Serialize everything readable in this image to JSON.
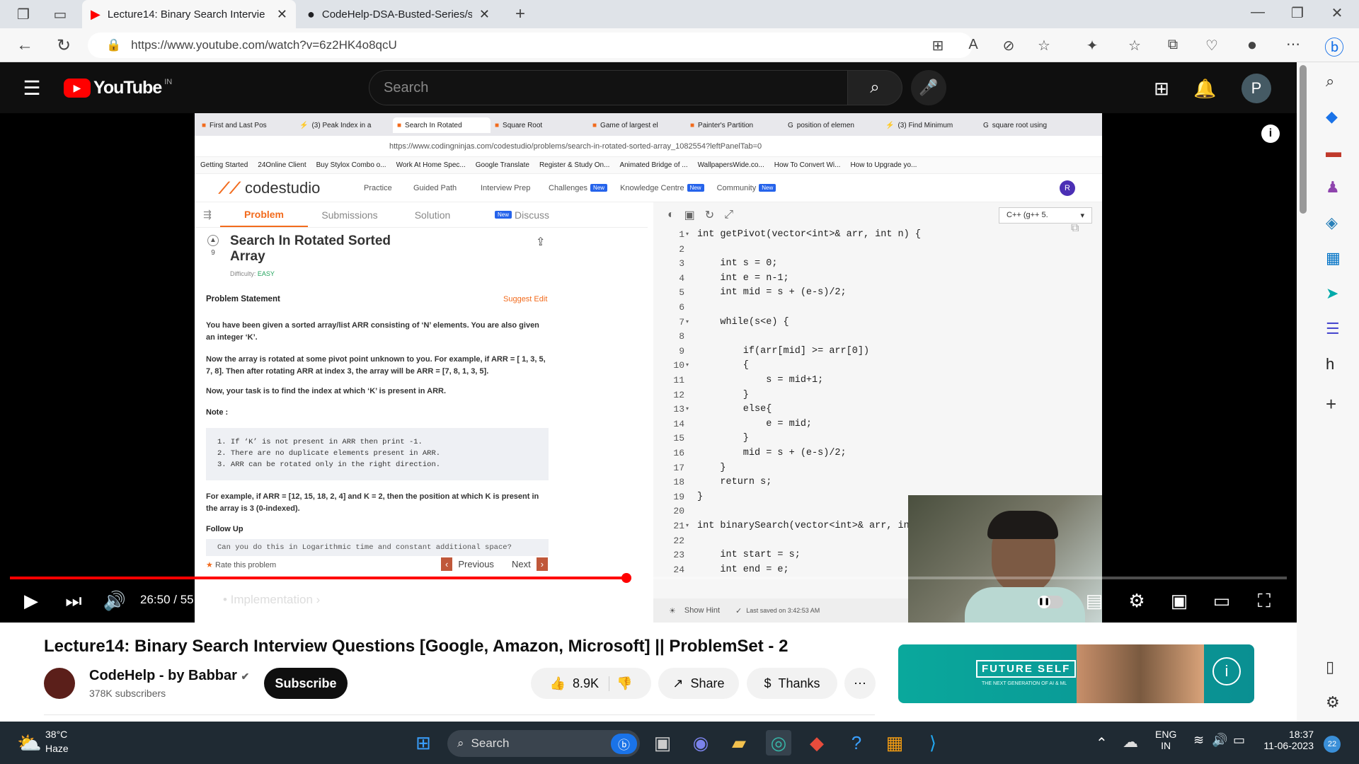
{
  "browser": {
    "tabs": [
      {
        "title": "Lecture14: Binary Search Intervie",
        "icon": "youtube-icon",
        "active": true
      },
      {
        "title": "CodeHelp-DSA-Busted-Series/se",
        "icon": "github-icon",
        "active": false
      }
    ],
    "url": "https://www.youtube.com/watch?v=6z2HK4o8qcU"
  },
  "youtube": {
    "logo": "YouTube",
    "country": "IN",
    "search_placeholder": "Search",
    "avatar_letter": "P"
  },
  "video": {
    "inner_tabs": [
      "First and Last Pos",
      "(3) Peak Index in a",
      "Search In Rotated",
      "Square Root",
      "Game of largest el",
      "Painter's Partition",
      "position of elemen",
      "(3) Find Minimum",
      "square root using"
    ],
    "inner_url": "https://www.codingninjas.com/codestudio/problems/search-in-rotated-sorted-array_1082554?leftPanelTab=0",
    "bookmarks": [
      "Getting Started",
      "24Online Client",
      "Buy Stylox Combo o...",
      "Work At Home Spec...",
      "Google Translate",
      "Register & Study On...",
      "Animated Bridge of ...",
      "WallpapersWide.co...",
      "How To Convert Wi...",
      "How to Upgrade yo..."
    ],
    "codestudio": {
      "logo": "codestudio",
      "nav": [
        "Practice",
        "Guided Path",
        "Interview Prep",
        "Challenges",
        "Knowledge Centre",
        "Community"
      ],
      "new_badge": "New",
      "user_initial": "R",
      "problem_tabs": [
        "Problem",
        "Submissions",
        "Solution",
        "Discuss"
      ],
      "upvotes": "9",
      "problem_title_line1": "Search In Rotated Sorted",
      "problem_title_line2": "Array",
      "difficulty_label": "Difficulty:",
      "difficulty": "EASY",
      "statement_heading": "Problem Statement",
      "suggest_edit": "Suggest Edit",
      "para1": "You have been given a sorted array/list ARR consisting of ‘N’ elements. You are also given an integer ‘K’.",
      "para2": "Now the array is rotated at some pivot point unknown to you. For example, if ARR = [ 1, 3, 5, 7, 8]. Then after rotating ARR at index 3, the array will be ARR = [7, 8, 1, 3, 5].",
      "para3": "Now, your task is to find the index at which ‘K’ is present in ARR.",
      "note": "Note :",
      "notes": [
        "1. If ‘K’ is not present in ARR then print -1.",
        "2. There are no duplicate elements present in ARR.",
        "3. ARR can be rotated only in the right direction."
      ],
      "example": "For example, if ARR = [12, 15, 18, 2, 4] and K = 2, then the position at which K is present in the array is 3 (0-indexed).",
      "follow_up": "Follow Up",
      "follow_up_text": "Can you do this in Logarithmic time and constant additional space?",
      "rate": "Rate this problem",
      "previous": "Previous",
      "next": "Next",
      "language": "C++ (g++ 5.",
      "show_hint": "Show Hint",
      "last_saved": "Last saved on 3:42:53 AM",
      "code": [
        "int getPivot(vector<int>& arr, int n) {",
        "",
        "    int s = 0;",
        "    int e = n-1;",
        "    int mid = s + (e-s)/2;",
        "",
        "    while(s<e) {",
        "",
        "        if(arr[mid] >= arr[0])",
        "        {",
        "            s = mid+1;",
        "        }",
        "        else{",
        "            e = mid;",
        "        }",
        "        mid = s + (e-s)/2;",
        "    }",
        "    return s;",
        "}",
        "",
        "int binarySearch(vector<int>& arr, int",
        "",
        "    int start = s;",
        "    int end = e;"
      ],
      "line_numbers": [
        "1",
        "2",
        "3",
        "4",
        "5",
        "6",
        "7",
        "8",
        "9",
        "10",
        "11",
        "12",
        "13",
        "14",
        "15",
        "16",
        "17",
        "18",
        "19",
        "20",
        "21",
        "22",
        "23",
        "24"
      ]
    },
    "time": "26:50 / 55:34",
    "chapter": "• Implementation",
    "progress_fraction": 0.483,
    "title": "Lecture14: Binary Search Interview Questions [Google, Amazon, Microsoft] || ProblemSet - 2",
    "channel": "CodeHelp - by Babbar",
    "subscribers": "378K subscribers",
    "subscribe": "Subscribe",
    "likes": "8.9K",
    "share": "Share",
    "thanks": "Thanks",
    "ad_brand": "FUTURE SELF",
    "ad_tagline": "THE NEXT GENERATION OF AI & ML"
  },
  "taskbar": {
    "weather_temp": "38°C",
    "weather_desc": "Haze",
    "search": "Search",
    "lang1": "ENG",
    "lang2": "IN",
    "time": "18:37",
    "date": "11-06-2023",
    "notif_count": "22"
  },
  "colors": {
    "yt_red": "#ff0000",
    "taskbar_bg": "#1f2a33",
    "codestudio_orange": "#f26b1d"
  }
}
